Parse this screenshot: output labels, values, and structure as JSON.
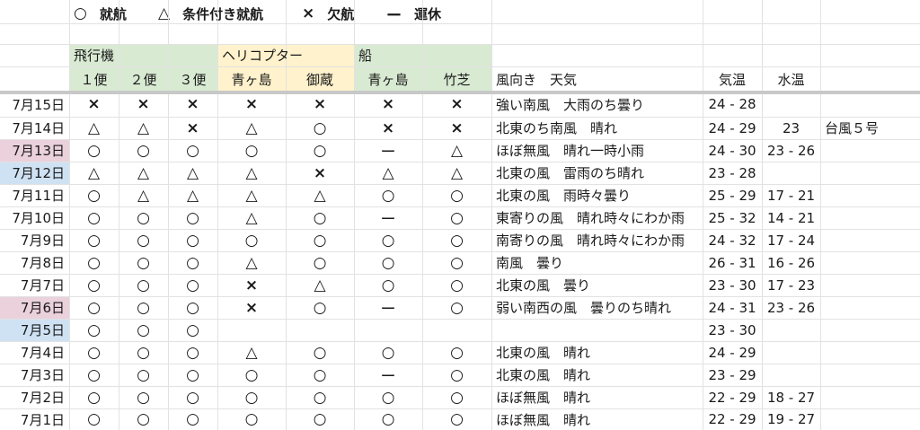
{
  "legend": [
    {
      "symbol": "○",
      "label": "就航"
    },
    {
      "symbol": "△",
      "label": "条件付き就航"
    },
    {
      "symbol": "×",
      "label": "欠航"
    },
    {
      "symbol": "ー",
      "label": "運休"
    }
  ],
  "groups": {
    "plane": "飛行機",
    "heli": "ヘリコプター",
    "ship": "船"
  },
  "colors": {
    "plane_bg": "#d9ead3",
    "heli_bg": "#fff2cc",
    "ship_bg": "#d9ead3",
    "pink_date": "#ead1dc",
    "blue_date": "#cfe2f3"
  },
  "columns": [
    "１便",
    "２便",
    "３便",
    "青ヶ島",
    "御蔵",
    "青ヶ島",
    "竹芝"
  ],
  "extra_headers": {
    "weather": "風向き　天気",
    "air_temp": "気温",
    "water_temp": "水温"
  },
  "rows": [
    {
      "date": "7月15日",
      "hl": "",
      "s": [
        "×",
        "×",
        "×",
        "×",
        "×",
        "×",
        "×"
      ],
      "weather": "強い南風　大雨のち曇り",
      "air": "24 - 28",
      "water": "",
      "note": ""
    },
    {
      "date": "7月14日",
      "hl": "",
      "s": [
        "△",
        "△",
        "×",
        "△",
        "○",
        "×",
        "×"
      ],
      "weather": "北東のち南風　晴れ",
      "air": "24 - 29",
      "water": "23",
      "note": "台風５号"
    },
    {
      "date": "7月13日",
      "hl": "pink",
      "s": [
        "○",
        "○",
        "○",
        "○",
        "○",
        "ー",
        "△"
      ],
      "weather": "ほぼ無風　晴れ一時小雨",
      "air": "24 - 30",
      "water": "23 - 26",
      "note": ""
    },
    {
      "date": "7月12日",
      "hl": "blue",
      "s": [
        "△",
        "△",
        "△",
        "△",
        "×",
        "△",
        "△"
      ],
      "weather": "北東の風　雷雨のち晴れ",
      "air": "23 - 28",
      "water": "",
      "note": ""
    },
    {
      "date": "7月11日",
      "hl": "",
      "s": [
        "○",
        "△",
        "△",
        "△",
        "△",
        "○",
        "○"
      ],
      "weather": "北東の風　雨時々曇り",
      "air": "25 - 29",
      "water": "17 - 21",
      "note": ""
    },
    {
      "date": "7月10日",
      "hl": "",
      "s": [
        "○",
        "○",
        "○",
        "△",
        "○",
        "ー",
        "○"
      ],
      "weather": "東寄りの風　晴れ時々にわか雨",
      "air": "25 - 32",
      "water": "14 - 21",
      "note": ""
    },
    {
      "date": "7月9日",
      "hl": "",
      "s": [
        "○",
        "○",
        "○",
        "○",
        "○",
        "○",
        "○"
      ],
      "weather": "南寄りの風　晴れ時々にわか雨",
      "air": "24 - 32",
      "water": "17 - 24",
      "note": ""
    },
    {
      "date": "7月8日",
      "hl": "",
      "s": [
        "○",
        "○",
        "○",
        "△",
        "○",
        "○",
        "○"
      ],
      "weather": "南風　曇り",
      "air": "26 - 31",
      "water": "16 - 26",
      "note": ""
    },
    {
      "date": "7月7日",
      "hl": "",
      "s": [
        "○",
        "○",
        "○",
        "×",
        "△",
        "○",
        "○"
      ],
      "weather": "北東の風　曇り",
      "air": "23 - 30",
      "water": "17 - 23",
      "note": ""
    },
    {
      "date": "7月6日",
      "hl": "pink",
      "s": [
        "○",
        "○",
        "○",
        "×",
        "○",
        "ー",
        "○"
      ],
      "weather": "弱い南西の風　曇りのち晴れ",
      "air": "24 - 31",
      "water": "23 - 26",
      "note": ""
    },
    {
      "date": "7月5日",
      "hl": "blue",
      "s": [
        "○",
        "○",
        "○",
        "",
        "",
        "",
        ""
      ],
      "weather": "",
      "air": "23 - 30",
      "water": "",
      "note": ""
    },
    {
      "date": "7月4日",
      "hl": "",
      "s": [
        "○",
        "○",
        "○",
        "△",
        "○",
        "○",
        "○"
      ],
      "weather": "北東の風　晴れ",
      "air": "24 - 29",
      "water": "",
      "note": ""
    },
    {
      "date": "7月3日",
      "hl": "",
      "s": [
        "○",
        "○",
        "○",
        "○",
        "○",
        "ー",
        "○"
      ],
      "weather": "北東の風　晴れ",
      "air": "23 - 29",
      "water": "",
      "note": ""
    },
    {
      "date": "7月2日",
      "hl": "",
      "s": [
        "○",
        "○",
        "○",
        "○",
        "○",
        "○",
        "○"
      ],
      "weather": "ほぼ無風　晴れ",
      "air": "22 - 29",
      "water": "18 - 27",
      "note": ""
    },
    {
      "date": "7月1日",
      "hl": "",
      "s": [
        "○",
        "○",
        "○",
        "○",
        "○",
        "○",
        "○"
      ],
      "weather": "ほぼ無風　晴れ",
      "air": "22 - 29",
      "water": "19 - 27",
      "note": ""
    }
  ]
}
